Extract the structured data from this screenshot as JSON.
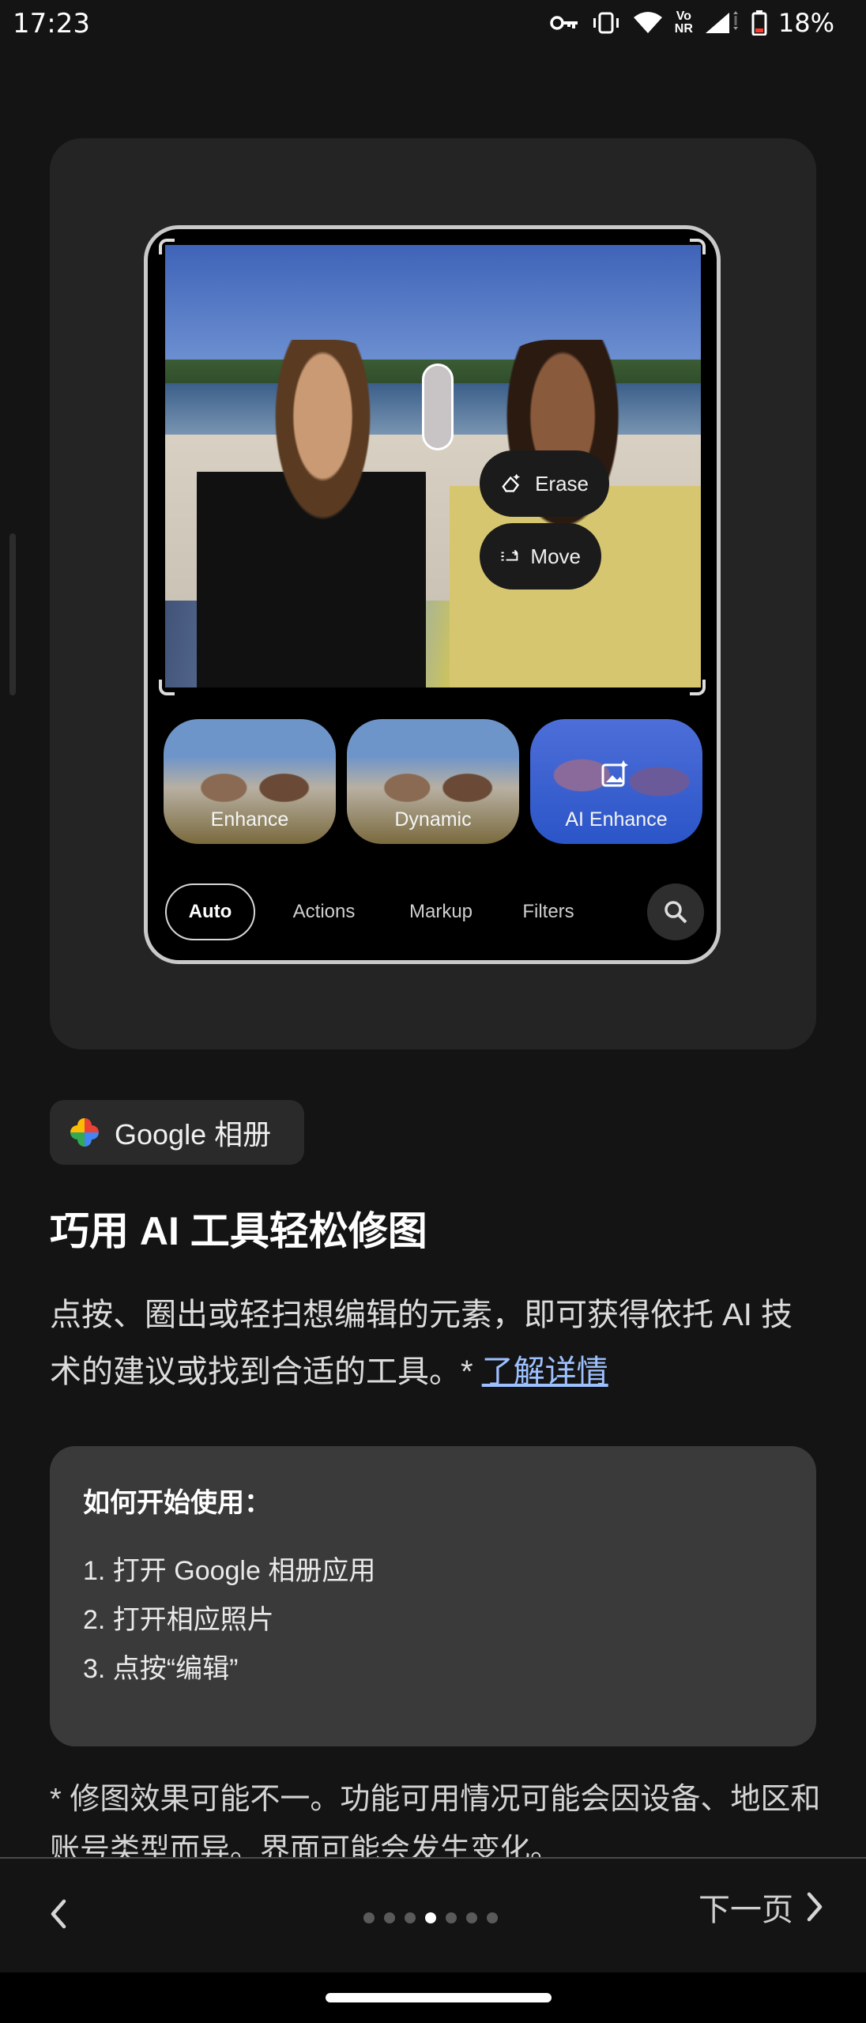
{
  "status_bar": {
    "time": "17:23",
    "volte_top": "Vo",
    "volte_bottom": "NR",
    "battery": "18%"
  },
  "hero": {
    "erase_label": "Erase",
    "move_label": "Move",
    "filters": [
      "Enhance",
      "Dynamic",
      "AI Enhance"
    ],
    "tabs": [
      "Auto",
      "Actions",
      "Markup",
      "Filters"
    ]
  },
  "app_chip": {
    "label": "Google 相册"
  },
  "headline": "巧用 AI 工具轻松修图",
  "body": {
    "text": "点按、圈出或轻扫想编辑的元素，即可获得依托 AI 技术的建议或找到合适的工具。* ",
    "link": "了解详情"
  },
  "steps": {
    "title": "如何开始使用：",
    "items": [
      "1.  打开 Google 相册应用",
      "2.  打开相应照片",
      "3.  点按“编辑”"
    ]
  },
  "disclaimer": "* 修图效果可能不一。功能可用情况可能会因设备、地区和账号类型而异。界面可能会发生变化。",
  "nav": {
    "next_label": "下一页",
    "page_index": 4,
    "page_count": 7
  },
  "colors": {
    "background": "#141414",
    "card": "#242424",
    "steps_card": "#3a3a3a",
    "link": "#9dc0ff",
    "ai_enhance": "#2b55c8"
  }
}
